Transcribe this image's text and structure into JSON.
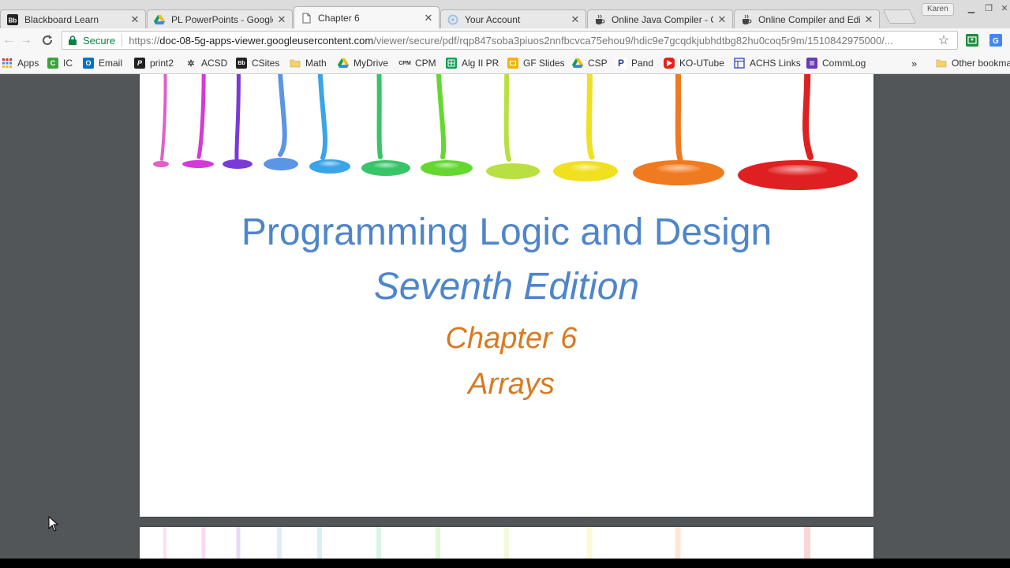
{
  "tabs": [
    {
      "title": "Blackboard Learn",
      "icon": "blackboard-icon"
    },
    {
      "title": "PL PowerPoints - Google",
      "icon": "google-drive-icon"
    },
    {
      "title": "Chapter 6",
      "icon": "document-icon"
    },
    {
      "title": "Your Account",
      "icon": "loading-icon"
    },
    {
      "title": "Online Java Compiler - C",
      "icon": "coffee-cup-icon"
    },
    {
      "title": "Online Compiler and Edi",
      "icon": "coffee-cup-icon"
    }
  ],
  "profile": "Karen",
  "address": {
    "secure_label": "Secure",
    "url_scheme": "https://",
    "url_host": "doc-08-5g-apps-viewer.googleusercontent.com",
    "url_path": "/viewer/secure/pdf/rqp847soba3piuos2nnfbcvca75ehou9/hdic9e7gcqdkjubhdtbg82hu0coq5r9m/1510842975000/..."
  },
  "bookmarks": {
    "items": [
      {
        "label": "Apps",
        "icon": "apps-grid-icon"
      },
      {
        "label": "IC",
        "icon": "infinite-campus-icon"
      },
      {
        "label": "Email",
        "icon": "outlook-icon"
      },
      {
        "label": "print2",
        "icon": "print-icon"
      },
      {
        "label": "ACSD",
        "icon": "acsd-icon"
      },
      {
        "label": "CSites",
        "icon": "blackboard-icon"
      },
      {
        "label": "Math",
        "icon": "folder-icon"
      },
      {
        "label": "MyDrive",
        "icon": "google-drive-icon"
      },
      {
        "label": "CPM",
        "icon": "cpm-icon"
      },
      {
        "label": "Alg II PR",
        "icon": "sheets-icon"
      },
      {
        "label": "GF Slides",
        "icon": "slides-icon"
      },
      {
        "label": "CSP",
        "icon": "google-drive-icon"
      },
      {
        "label": "Pand",
        "icon": "pandora-icon"
      },
      {
        "label": "KO-UTube",
        "icon": "youtube-icon"
      },
      {
        "label": "ACHS Links",
        "icon": "sites-icon"
      },
      {
        "label": "CommLog",
        "icon": "forms-icon"
      }
    ],
    "more": "»",
    "other": "Other bookma"
  },
  "slide": {
    "title_line1": "Programming Logic and Design",
    "title_line2": "Seventh Edition",
    "chapter": "Chapter 6",
    "topic": "Arrays"
  },
  "colors": {
    "title_blue": "#4f85c9",
    "chapter_orange": "#d87a20",
    "viewer_bg": "#525659",
    "secure_green": "#0b8043"
  }
}
